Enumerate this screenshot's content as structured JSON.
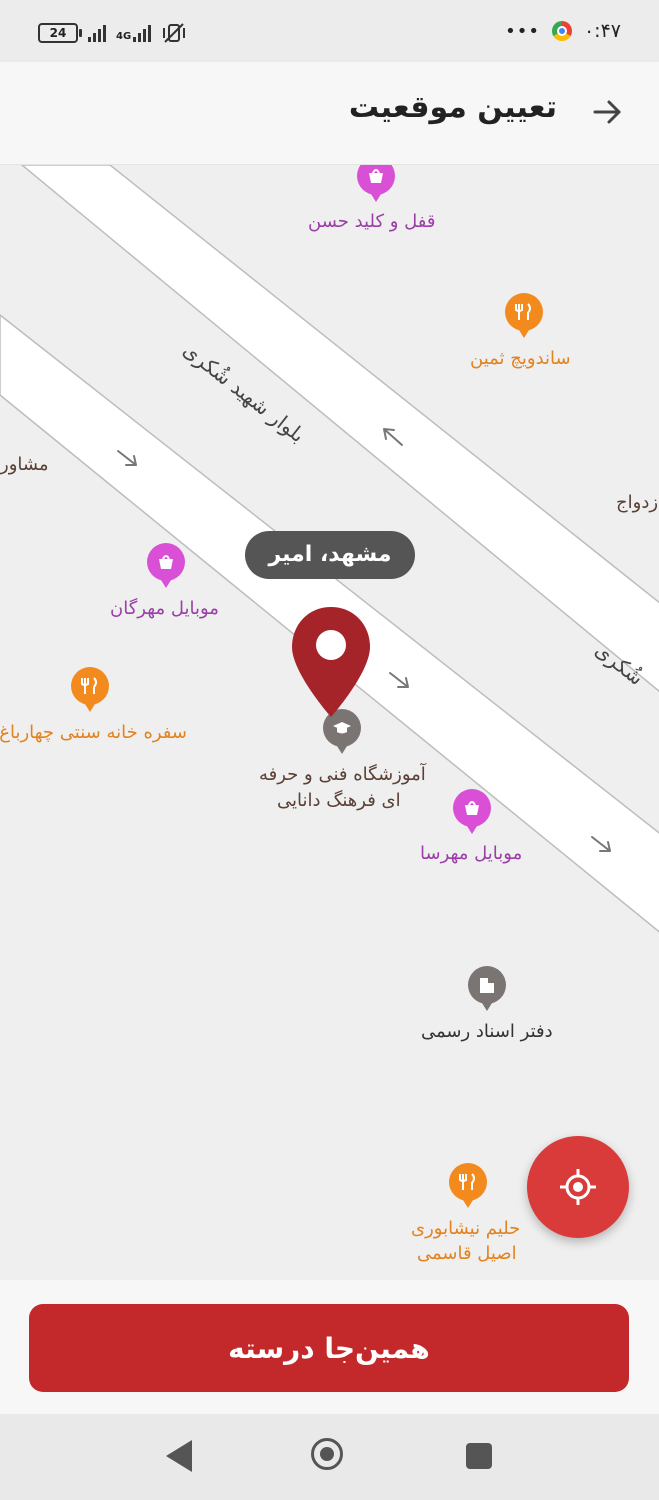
{
  "status_bar": {
    "time": "۰:۴۷",
    "battery": "24",
    "network": "4G",
    "overflow": "•••"
  },
  "header": {
    "title": "تعیین موقعیت"
  },
  "map": {
    "tooltip": "مشهد، امیر",
    "roads": {
      "main": "بلوار شهید شُکری",
      "partial": "شُکری"
    },
    "pois": {
      "lock_shop": "قفل و کلید حسن",
      "sandwich": "ساندویچ ثمین",
      "consult": "مشاور",
      "marriage": "زدواج",
      "mobile_mehrgan": "موبایل مهرگان",
      "traditional_food": "سفره خانه سنتی چهارباغ",
      "school_line1": "آموزشگاه فنی و حرفه",
      "school_line2": "ای فرهنگ دانایی",
      "mobile_mehrsa": "موبایل مهرسا",
      "notary": "دفتر اسناد رسمی",
      "haleem_line1": "حلیم نیشابوری",
      "haleem_line2": "اصیل قاسمی"
    }
  },
  "actions": {
    "confirm": "همین‌جا درسته"
  },
  "colors": {
    "primary": "#c3292b",
    "fab": "#d93a3a",
    "pin": "#a5242a",
    "shop": "#d94fd6",
    "food": "#f28a1e"
  }
}
